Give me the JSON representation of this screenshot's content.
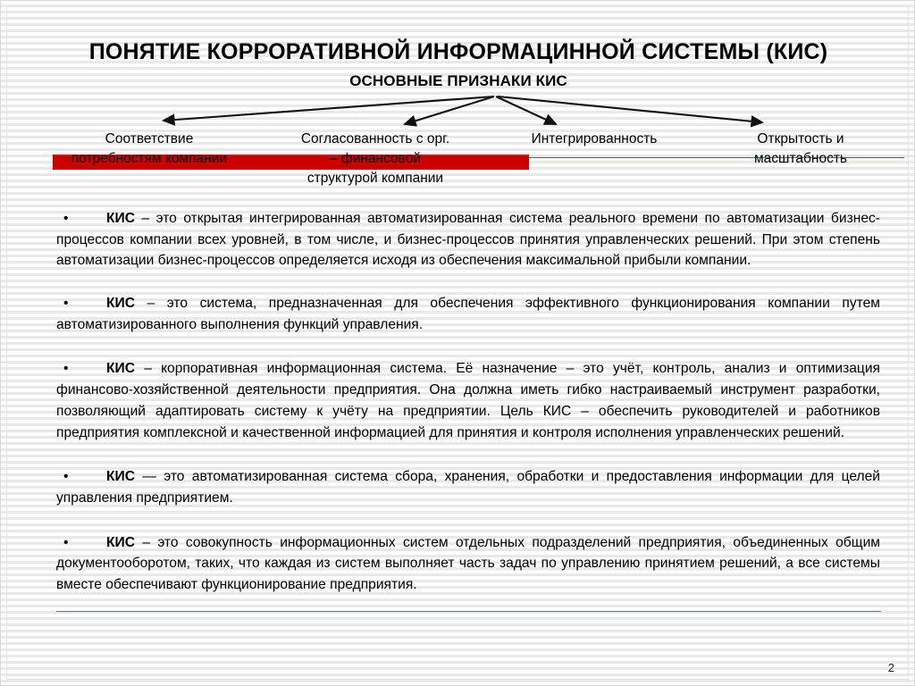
{
  "slide": {
    "title": "ПОНЯТИЕ КОРРОРАТИВНОЙ ИНФОРМАЦИННОЙ СИСТЕМЫ (КИС)",
    "subtitle": "ОСНОВНЫЕ ПРИЗНАКИ КИС",
    "page_number": "2",
    "accent_color": "#cc0000",
    "rule_color": "#cc3333",
    "text_color": "#000000",
    "background_color": "#ffffff",
    "stripe_color": "#e9e9ec"
  },
  "diagram": {
    "root_label": "ОСНОВНЫЕ ПРИЗНАКИ КИС",
    "branches": [
      {
        "id": "branch-1",
        "label": "Соответствие\nпотребностям компании"
      },
      {
        "id": "branch-2",
        "label": "Согласованность с орг.\n– финансовой\nструктурой компании"
      },
      {
        "id": "branch-3",
        "label": "Интегрированность"
      },
      {
        "id": "branch-4",
        "label": "Открытость и\nмасштабность"
      }
    ]
  },
  "body": {
    "paragraphs": [
      {
        "bullet": "•",
        "lead": "КИС",
        "text": " – это открытая интегрированная автоматизированная система реального времени по автоматизации бизнес-процессов компании всех уровней, в том числе, и бизнес-процессов принятия управленческих решений. При этом степень автоматизации бизнес-процессов определяется исходя из обеспечения максимальной прибыли компании."
      },
      {
        "bullet": "•",
        "lead": "КИС",
        "text": " – это   система, предназначенная для обеспечения эффективного функционирования компании путем автоматизированного выполнения функций управления."
      },
      {
        "bullet": "•",
        "lead": "КИС",
        "text": " – корпоративная   информационная система. Её назначение – это учёт, контроль, анализ и оптимизация финансово-хозяйственной деятельности предприятия. Она должна иметь гибко настраиваемый инструмент разработки, позволяющий адаптировать систему к учёту на предприятии. Цель КИС – обеспечить  руководителей и работников предприятия комплексной и качественной информацией для принятия и контроля исполнения управленческих решений."
      },
      {
        "bullet": "•",
        "lead": "КИС",
        "text": "  — это автоматизированная система сбора, хранения, обработки и предоставления информации для целей управления предприятием."
      },
      {
        "bullet": "•",
        "lead": "КИС",
        "text": " – это   совокупность информационных систем отдельных подразделений предприятия, объединенных общим документооборотом, таких, что каждая из систем выполняет часть задач по управлению принятием решений, а все системы вместе обеспечивают функционирование предприятия."
      }
    ]
  }
}
